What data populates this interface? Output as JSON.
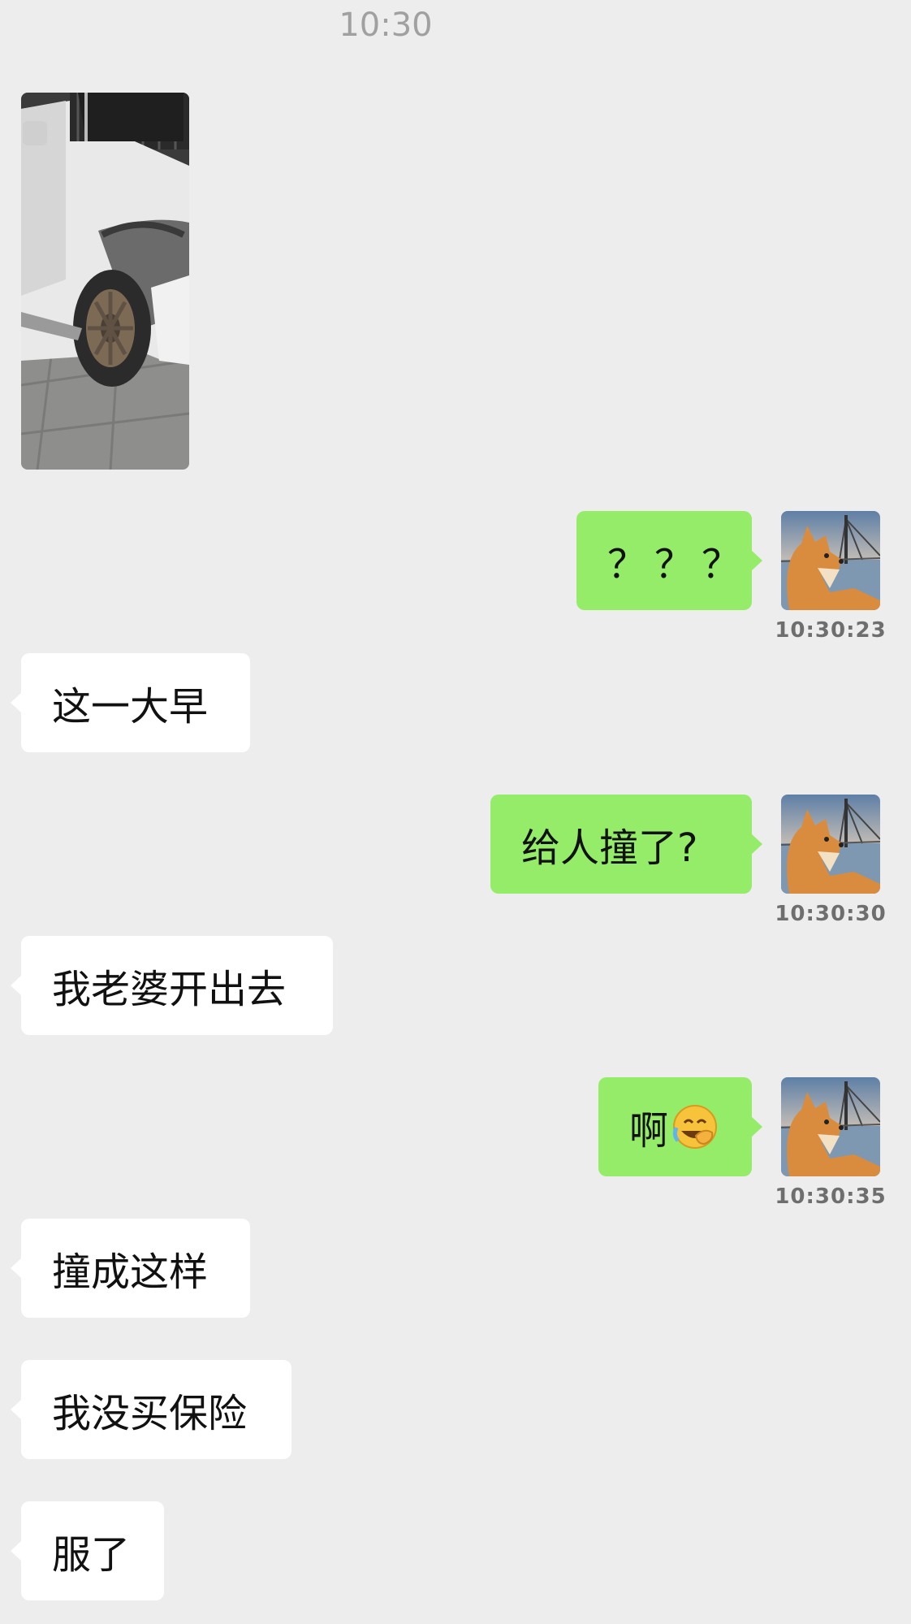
{
  "header": {
    "time": "10:30"
  },
  "messages": [
    {
      "type": "image",
      "side": "left",
      "content": "car-photo"
    },
    {
      "side": "right",
      "text": "？？？",
      "timestamp": "10:30:23"
    },
    {
      "side": "left",
      "text": "这一大早"
    },
    {
      "side": "right",
      "text": "给人撞了?",
      "timestamp": "10:30:30"
    },
    {
      "side": "left",
      "text": "我老婆开出去"
    },
    {
      "side": "right",
      "text": "啊",
      "emoji": "facepalm-laugh-emoji",
      "timestamp": "10:30:35"
    },
    {
      "side": "left",
      "text": "撞成这样"
    },
    {
      "side": "left",
      "text": "我没买保险"
    },
    {
      "side": "left",
      "text": "服了"
    }
  ],
  "colors": {
    "background": "#ededed",
    "incoming_bubble": "#ffffff",
    "outgoing_bubble": "#95ec69",
    "timestamp": "#6e6e6e"
  }
}
